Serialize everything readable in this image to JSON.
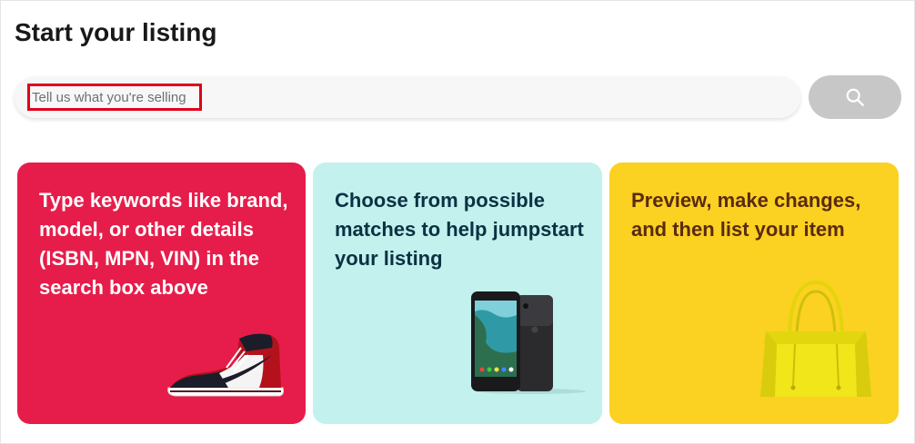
{
  "page": {
    "title": "Start your listing"
  },
  "search": {
    "placeholder": "Tell us what you're selling",
    "button_icon": "search-icon"
  },
  "cards": [
    {
      "text": "Type keywords like brand, model, or other details (ISBN, MPN, VIN) in the search box above",
      "image_icon": "sneaker-icon",
      "color": "#e61d4a"
    },
    {
      "text": "Choose from possible matches to help jumpstart your listing",
      "image_icon": "smartphone-icon",
      "color": "#c2f1ee"
    },
    {
      "text": "Preview, make changes, and then list your item",
      "image_icon": "handbag-icon",
      "color": "#fbd122"
    }
  ]
}
